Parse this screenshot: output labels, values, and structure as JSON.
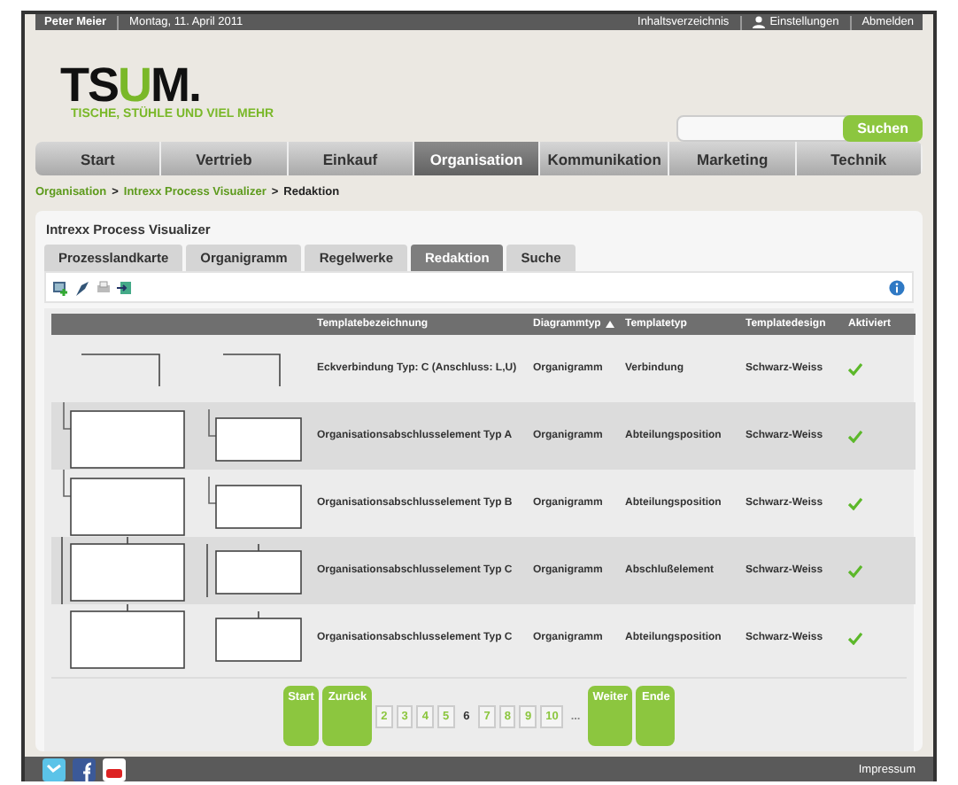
{
  "top_bar": {
    "user": "Peter Meier",
    "date": "Montag, 11. April 2011",
    "links": [
      {
        "label": "Inhaltsverzeichnis",
        "icon": false
      },
      {
        "label": "Einstellungen",
        "icon": true
      },
      {
        "label": "Abmelden",
        "icon": false
      }
    ]
  },
  "logo": {
    "letters": [
      "TS",
      "U",
      "M",
      "."
    ],
    "tagline": "TISCHE, STÜHLE UND VIEL MEHR"
  },
  "search": {
    "button": "Suchen"
  },
  "nav": [
    {
      "label": "Start",
      "selected": false
    },
    {
      "label": "Vertrieb",
      "selected": false
    },
    {
      "label": "Einkauf",
      "selected": false
    },
    {
      "label": "Organisation",
      "selected": true
    },
    {
      "label": "Kommunikation",
      "selected": false
    },
    {
      "label": "Marketing",
      "selected": false
    },
    {
      "label": "Technik",
      "selected": false
    }
  ],
  "breadcrumb": [
    {
      "label": "Organisation",
      "link": true
    },
    {
      "label": ">",
      "link": false
    },
    {
      "label": "Intrexx Process Visualizer",
      "link": true
    },
    {
      "label": ">",
      "link": false
    },
    {
      "label": "Redaktion",
      "link": false
    }
  ],
  "panel": {
    "title": "Intrexx Process Visualizer"
  },
  "tabs": [
    {
      "label": "Prozesslandkarte",
      "selected": false
    },
    {
      "label": "Organigramm",
      "selected": false
    },
    {
      "label": "Regelwerke",
      "selected": false
    },
    {
      "label": "Redaktion",
      "selected": true
    },
    {
      "label": "Suche",
      "selected": false
    }
  ],
  "table": {
    "columns": [
      {
        "label": "Templatebezeichnung",
        "sorted": false
      },
      {
        "label": "Diagrammtyp",
        "sorted": true
      },
      {
        "label": "Templatetyp",
        "sorted": false
      },
      {
        "label": "Templatedesign",
        "sorted": false
      },
      {
        "label": "Aktiviert",
        "sorted": false
      }
    ],
    "rows": [
      {
        "kind": "corner",
        "name": "Eckverbindung Typ: C (Anschluss: L,U)",
        "diagram": "Organigramm",
        "type": "Verbindung",
        "design": "Schwarz-Weiss",
        "active": true
      },
      {
        "kind": "hook",
        "name": "Organisationsabschlusselement Typ A",
        "diagram": "Organigramm",
        "type": "Abteilungsposition",
        "design": "Schwarz-Weiss",
        "active": true
      },
      {
        "kind": "hook",
        "name": "Organisationsabschlusselement Typ B",
        "diagram": "Organigramm",
        "type": "Abteilungsposition",
        "design": "Schwarz-Weiss",
        "active": true
      },
      {
        "kind": "bar",
        "name": "Organisationsabschlusselement Typ C",
        "diagram": "Organigramm",
        "type": "Abschlußelement",
        "design": "Schwarz-Weiss",
        "active": true
      },
      {
        "kind": "tick",
        "name": "Organisationsabschlusselement Typ C",
        "diagram": "Organigramm",
        "type": "Abteilungsposition",
        "design": "Schwarz-Weiss",
        "active": true
      }
    ]
  },
  "pagination": [
    {
      "kind": "nav",
      "label": "Start"
    },
    {
      "kind": "nav",
      "label": "Zurück"
    },
    {
      "kind": "page",
      "label": "2",
      "selected": false
    },
    {
      "kind": "page",
      "label": "3",
      "selected": false
    },
    {
      "kind": "page",
      "label": "4",
      "selected": false
    },
    {
      "kind": "page",
      "label": "5",
      "selected": false
    },
    {
      "kind": "page",
      "label": "6",
      "selected": true
    },
    {
      "kind": "page",
      "label": "7",
      "selected": false
    },
    {
      "kind": "page",
      "label": "8",
      "selected": false
    },
    {
      "kind": "page",
      "label": "9",
      "selected": false
    },
    {
      "kind": "page",
      "label": "10",
      "selected": false
    },
    {
      "kind": "gap",
      "label": "..."
    },
    {
      "kind": "nav",
      "label": "Weiter"
    },
    {
      "kind": "nav",
      "label": "Ende"
    }
  ],
  "footer": {
    "link": "Impressum"
  }
}
